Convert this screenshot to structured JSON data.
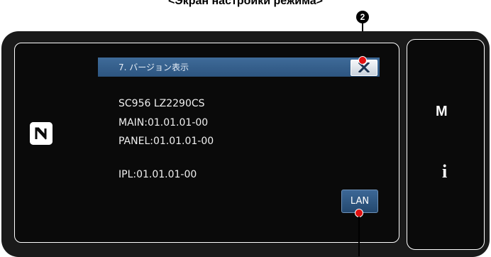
{
  "caption": "<Экран настройки режима>",
  "callout_number": "2",
  "dialog": {
    "title": "7. バージョン表示",
    "close_icon": "close-x-icon"
  },
  "version_lines": [
    "SC956 LZ2290CS",
    "MAIN:01.01.01-00",
    "PANEL:01.01.01-00",
    "IPL:01.01.01-00"
  ],
  "lan_button_label": "LAN",
  "side": {
    "mode_label": "M",
    "info_label": "i"
  },
  "colors": {
    "title_bar": "#2d5580",
    "callout_marker": "#e01010",
    "screen_background": "#0a0a0a"
  }
}
